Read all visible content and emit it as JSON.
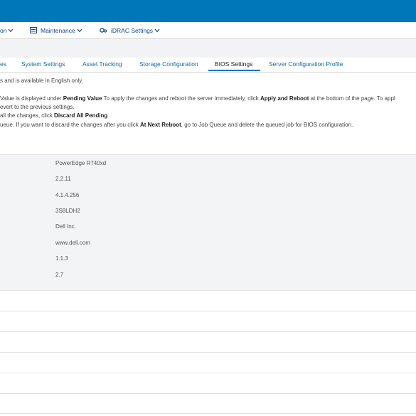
{
  "menu": {
    "items": [
      {
        "label": "on",
        "icon": "none"
      },
      {
        "label": "Maintenance",
        "icon": "maintenance-icon"
      },
      {
        "label": "iDRAC Settings",
        "icon": "settings-icon"
      }
    ]
  },
  "tabs": [
    {
      "label": "es"
    },
    {
      "label": "System Settings"
    },
    {
      "label": "Asset Tracking"
    },
    {
      "label": "Storage Configuration"
    },
    {
      "label": "BIOS Settings",
      "active": true
    },
    {
      "label": "Server Configuration Profile"
    }
  ],
  "info": {
    "line1": "s and is available in English only.",
    "line2": {
      "a": "Value is displayed under ",
      "b": "Pending Value",
      "c": " To apply the changes and reboot the server immediately, click ",
      "d": "Apply and Reboot",
      "e": " at the bottom of the page. To appl"
    },
    "line3": "evert to the previous settings.",
    "line4": {
      "a": "all the changes, click ",
      "b": "Discard All Pending"
    },
    "line5": {
      "a": "ueue. If you want to discard the changes after you click ",
      "b": "At Next Reboot",
      "c": ", go to Job Queue and delete the queued job for BIOS configuration."
    }
  },
  "properties": {
    "values": [
      "PowerEdge R740xd",
      "2.2.11",
      "4.1.4.256",
      "3S8LDH2",
      "Dell Inc.",
      "www.dell.com",
      "1.1.3",
      "2.7"
    ]
  },
  "colors": {
    "header_blue": "#0077b8",
    "link_blue": "#0b6bb1",
    "panel_gray": "#f3f4f5"
  }
}
